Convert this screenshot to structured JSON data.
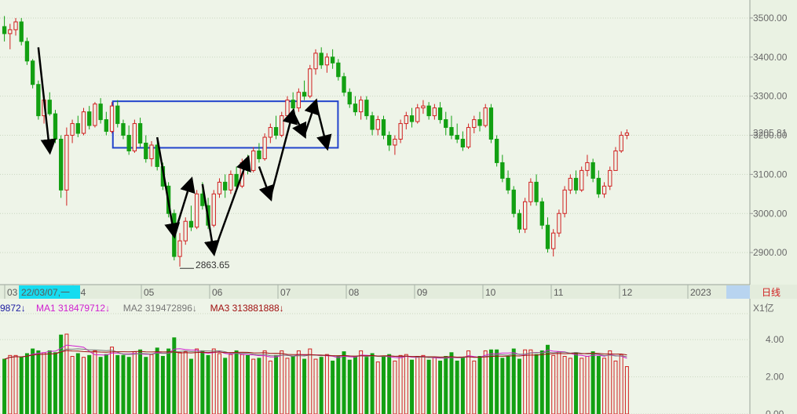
{
  "chart_data": [
    {
      "type": "candlestick",
      "title": "",
      "price_axis": {
        "ylim": [
          2820,
          3530
        ],
        "ticks": [
          "3500.00",
          "3400.00",
          "3300.00",
          "3200.00",
          "3100.00",
          "3000.00",
          "2900.00"
        ],
        "tick_values": [
          3500,
          3400,
          3300,
          3200,
          3100,
          3000,
          2900
        ]
      },
      "current_price_label": "3205.81",
      "current_price": 3205.81,
      "low_annotation": {
        "label": "2863.65",
        "value": 2863.65,
        "date_index": 31
      },
      "date_axis": {
        "labels": [
          "03",
          "04",
          "05",
          "06",
          "07",
          "08",
          "09",
          "10",
          "11",
          "12",
          "2023"
        ],
        "cursor_label": "22/03/07,一",
        "period_label": "日线"
      },
      "candles_ohlc": [
        [
          3478,
          3505,
          3440,
          3460
        ],
        [
          3460,
          3485,
          3420,
          3470
        ],
        [
          3470,
          3500,
          3455,
          3490
        ],
        [
          3490,
          3500,
          3430,
          3440
        ],
        [
          3440,
          3450,
          3380,
          3390
        ],
        [
          3390,
          3395,
          3320,
          3330
        ],
        [
          3330,
          3340,
          3240,
          3250
        ],
        [
          3250,
          3300,
          3230,
          3290
        ],
        [
          3290,
          3310,
          3250,
          3255
        ],
        [
          3255,
          3265,
          3180,
          3190
        ],
        [
          3190,
          3200,
          3040,
          3060
        ],
        [
          3060,
          3220,
          3020,
          3200
        ],
        [
          3200,
          3240,
          3180,
          3230
        ],
        [
          3230,
          3250,
          3195,
          3205
        ],
        [
          3205,
          3270,
          3200,
          3260
        ],
        [
          3260,
          3275,
          3215,
          3225
        ],
        [
          3225,
          3285,
          3220,
          3280
        ],
        [
          3280,
          3295,
          3230,
          3240
        ],
        [
          3240,
          3260,
          3200,
          3210
        ],
        [
          3210,
          3285,
          3205,
          3275
        ],
        [
          3275,
          3290,
          3220,
          3230
        ],
        [
          3230,
          3240,
          3190,
          3200
        ],
        [
          3200,
          3225,
          3150,
          3160
        ],
        [
          3160,
          3240,
          3155,
          3230
        ],
        [
          3230,
          3245,
          3170,
          3180
        ],
        [
          3180,
          3200,
          3130,
          3140
        ],
        [
          3140,
          3185,
          3120,
          3175
        ],
        [
          3175,
          3190,
          3110,
          3120
        ],
        [
          3120,
          3130,
          3060,
          3070
        ],
        [
          3070,
          3080,
          2990,
          3000
        ],
        [
          3000,
          3010,
          2880,
          2890
        ],
        [
          2890,
          2950,
          2864,
          2930
        ],
        [
          2930,
          2990,
          2920,
          2980
        ],
        [
          2980,
          3020,
          2955,
          2965
        ],
        [
          2965,
          3060,
          2960,
          3050
        ],
        [
          3050,
          3080,
          3010,
          3020
        ],
        [
          3020,
          3040,
          2960,
          2970
        ],
        [
          2970,
          3060,
          2965,
          3050
        ],
        [
          3050,
          3090,
          3040,
          3080
        ],
        [
          3080,
          3100,
          3040,
          3060
        ],
        [
          3060,
          3110,
          3050,
          3100
        ],
        [
          3100,
          3120,
          3060,
          3070
        ],
        [
          3070,
          3140,
          3065,
          3130
        ],
        [
          3130,
          3150,
          3100,
          3110
        ],
        [
          3110,
          3170,
          3105,
          3160
        ],
        [
          3160,
          3180,
          3130,
          3140
        ],
        [
          3140,
          3205,
          3135,
          3195
        ],
        [
          3195,
          3230,
          3180,
          3220
        ],
        [
          3220,
          3250,
          3190,
          3200
        ],
        [
          3200,
          3260,
          3195,
          3250
        ],
        [
          3250,
          3300,
          3240,
          3290
        ],
        [
          3290,
          3310,
          3260,
          3270
        ],
        [
          3270,
          3320,
          3260,
          3310
        ],
        [
          3310,
          3340,
          3290,
          3300
        ],
        [
          3300,
          3380,
          3295,
          3370
        ],
        [
          3370,
          3420,
          3355,
          3410
        ],
        [
          3410,
          3425,
          3370,
          3380
        ],
        [
          3380,
          3410,
          3360,
          3400
        ],
        [
          3400,
          3420,
          3370,
          3385
        ],
        [
          3385,
          3395,
          3340,
          3350
        ],
        [
          3350,
          3360,
          3300,
          3310
        ],
        [
          3310,
          3320,
          3270,
          3280
        ],
        [
          3280,
          3300,
          3250,
          3260
        ],
        [
          3260,
          3300,
          3240,
          3290
        ],
        [
          3290,
          3300,
          3240,
          3250
        ],
        [
          3250,
          3260,
          3200,
          3215
        ],
        [
          3215,
          3250,
          3200,
          3240
        ],
        [
          3240,
          3250,
          3190,
          3200
        ],
        [
          3200,
          3210,
          3160,
          3175
        ],
        [
          3175,
          3200,
          3150,
          3190
        ],
        [
          3190,
          3240,
          3180,
          3230
        ],
        [
          3230,
          3260,
          3215,
          3250
        ],
        [
          3250,
          3270,
          3220,
          3235
        ],
        [
          3235,
          3280,
          3230,
          3270
        ],
        [
          3270,
          3290,
          3255,
          3275
        ],
        [
          3275,
          3285,
          3240,
          3250
        ],
        [
          3250,
          3280,
          3240,
          3270
        ],
        [
          3270,
          3285,
          3230,
          3240
        ],
        [
          3240,
          3260,
          3200,
          3220
        ],
        [
          3220,
          3250,
          3190,
          3200
        ],
        [
          3200,
          3230,
          3180,
          3190
        ],
        [
          3190,
          3210,
          3160,
          3170
        ],
        [
          3170,
          3230,
          3165,
          3220
        ],
        [
          3220,
          3250,
          3205,
          3240
        ],
        [
          3240,
          3260,
          3210,
          3225
        ],
        [
          3225,
          3280,
          3220,
          3270
        ],
        [
          3270,
          3280,
          3180,
          3190
        ],
        [
          3190,
          3200,
          3120,
          3130
        ],
        [
          3130,
          3150,
          3080,
          3090
        ],
        [
          3090,
          3110,
          3050,
          3060
        ],
        [
          3060,
          3070,
          2990,
          3000
        ],
        [
          3000,
          3010,
          2950,
          2960
        ],
        [
          2960,
          3040,
          2950,
          3030
        ],
        [
          3030,
          3090,
          3020,
          3080
        ],
        [
          3080,
          3100,
          3020,
          3030
        ],
        [
          3030,
          3040,
          2960,
          2970
        ],
        [
          2970,
          2990,
          2900,
          2910
        ],
        [
          2910,
          2960,
          2890,
          2950
        ],
        [
          2950,
          3010,
          2940,
          3000
        ],
        [
          3000,
          3070,
          2990,
          3060
        ],
        [
          3060,
          3100,
          3050,
          3090
        ],
        [
          3090,
          3110,
          3050,
          3060
        ],
        [
          3060,
          3120,
          3055,
          3110
        ],
        [
          3110,
          3150,
          3095,
          3130
        ],
        [
          3130,
          3140,
          3080,
          3090
        ],
        [
          3090,
          3110,
          3040,
          3050
        ],
        [
          3050,
          3080,
          3040,
          3070
        ],
        [
          3070,
          3120,
          3060,
          3110
        ],
        [
          3110,
          3130,
          3170,
          3160
        ],
        [
          3160,
          3210,
          3155,
          3200
        ],
        [
          3200,
          3215,
          3190,
          3205.81
        ]
      ],
      "volume_axis": {
        "unit_label": "X1亿",
        "ticks": [
          "4.00",
          "2.00",
          "0.00"
        ],
        "tick_values": [
          4,
          2,
          0
        ],
        "ylim": [
          0,
          5.4
        ]
      },
      "volume_legend": [
        {
          "label": "9872↓",
          "color": "#1a1aa0"
        },
        {
          "label": "MA1 318479712↓",
          "color": "#d020d0"
        },
        {
          "label": "MA2 319472896↓",
          "color": "#777777"
        },
        {
          "label": "MA3 313881888↓",
          "color": "#a01010"
        }
      ],
      "annotations": {
        "consolidation_box": {
          "price_high": 3287,
          "price_low": 3168,
          "color": "#2244cc"
        },
        "trend_arrows": [
          [
            [
              6,
              3425
            ],
            [
              8,
              3160
            ]
          ],
          [
            [
              27,
              3195
            ],
            [
              30,
              2945
            ]
          ],
          [
            [
              30,
              2945
            ],
            [
              33,
              3085
            ]
          ],
          [
            [
              35,
              3075
            ],
            [
              37,
              2900
            ]
          ],
          [
            [
              37,
              2900
            ],
            [
              43,
              3140
            ]
          ],
          [
            [
              45,
              3120
            ],
            [
              47,
              3040
            ]
          ],
          [
            [
              47,
              3040
            ],
            [
              51,
              3260
            ]
          ],
          [
            [
              51,
              3260
            ],
            [
              53,
              3200
            ]
          ],
          [
            [
              53,
              3200
            ],
            [
              55,
              3285
            ]
          ],
          [
            [
              55,
              3285
            ],
            [
              57,
              3170
            ]
          ]
        ]
      }
    }
  ]
}
